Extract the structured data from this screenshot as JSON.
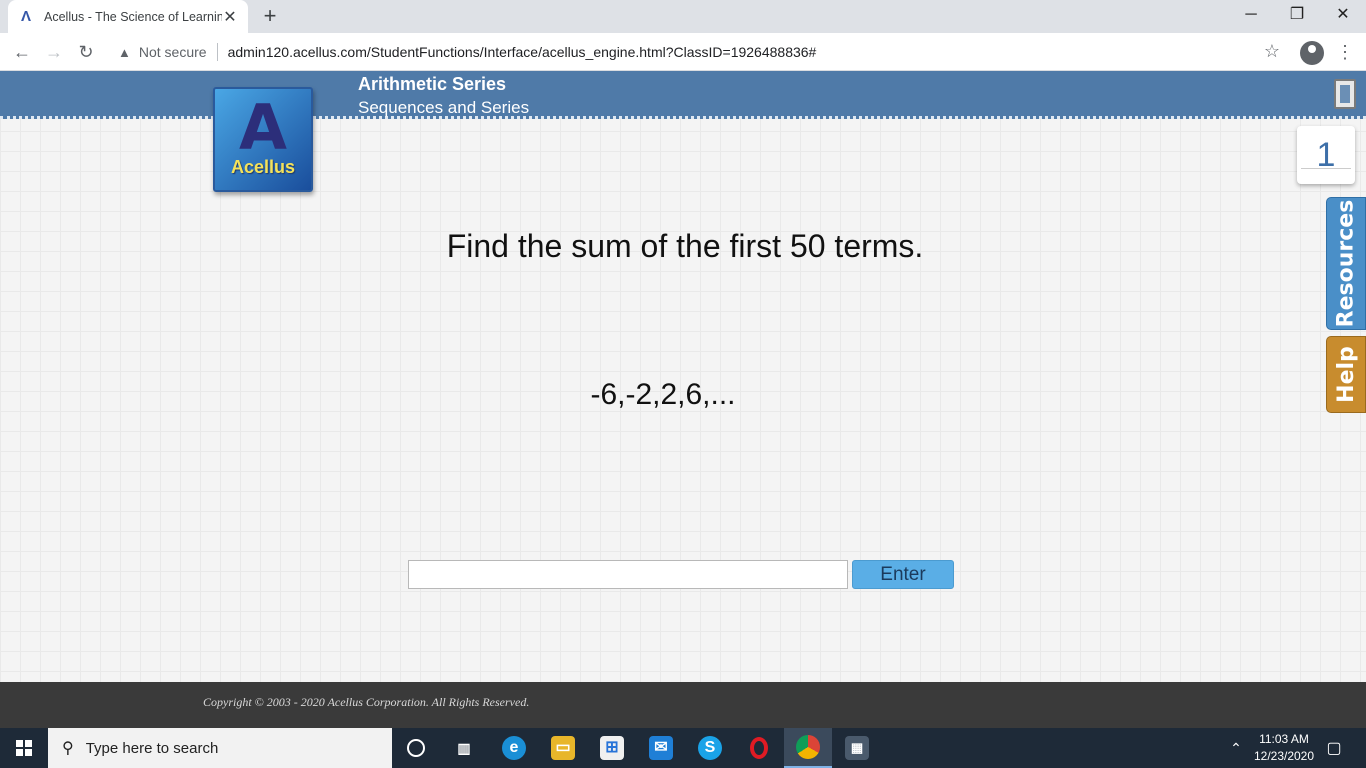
{
  "browser": {
    "tab_title": "Acellus - The Science of Learning",
    "tab_close": "✕",
    "new_tab": "+",
    "security_label": "Not secure",
    "url": "admin120.acellus.com/StudentFunctions/Interface/acellus_engine.html?ClassID=1926488836#",
    "window_controls": {
      "minimize": "─",
      "restore": "❐",
      "close": "✕"
    }
  },
  "header": {
    "title": "Arithmetic Series",
    "subtitle": "Sequences and Series"
  },
  "logo": {
    "mark": "A",
    "word": "Acellus"
  },
  "question": {
    "number": "1",
    "prompt": "Find the sum of the first 50 terms.",
    "sequence": "-6,-2,2,6,..."
  },
  "answer": {
    "value": "",
    "placeholder": "",
    "enter_label": "Enter"
  },
  "side_tabs": {
    "resources": "Resources",
    "help": "Help"
  },
  "footer": {
    "copyright": "Copyright © 2003 - 2020 Acellus Corporation.  All Rights Reserved."
  },
  "taskbar": {
    "search_placeholder": "Type here to search",
    "time": "11:03 AM",
    "date": "12/23/2020"
  },
  "colors": {
    "header": "#4f7aa8",
    "resources_tab": "#4a8fc8",
    "help_tab": "#c88c2e",
    "enter_button": "#5aaee6",
    "footer": "#3a3a3a",
    "taskbar": "#1e2a38"
  }
}
